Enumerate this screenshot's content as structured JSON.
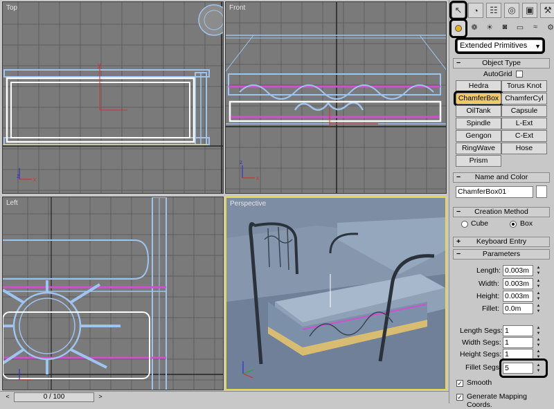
{
  "viewports": {
    "top": "Top",
    "front": "Front",
    "left": "Left",
    "perspective": "Perspective"
  },
  "panel": {
    "tabs_top": [
      "cursor-icon",
      "arc-icon",
      "hierarchy-icon",
      "motion-icon",
      "display-icon",
      "utilities-icon"
    ],
    "tabs_sub": [
      "geometry-icon",
      "shapes-icon",
      "lights-icon",
      "cameras-icon",
      "helpers-icon",
      "spacewarps-icon",
      "systems-icon"
    ],
    "dropdown": "Extended Primitives",
    "object_type": {
      "title": "Object Type",
      "autogrid": "AutoGrid",
      "buttons": [
        "Hedra",
        "Torus Knot",
        "ChamferBox",
        "ChamferCyl",
        "OilTank",
        "Capsule",
        "Spindle",
        "L-Ext",
        "Gengon",
        "C-Ext",
        "RingWave",
        "Hose",
        "Prism"
      ]
    },
    "name_color": {
      "title": "Name and Color",
      "name": "ChamferBox01"
    },
    "creation_method": {
      "title": "Creation Method",
      "cube": "Cube",
      "box": "Box"
    },
    "keyboard_entry": {
      "title": "Keyboard Entry"
    },
    "parameters": {
      "title": "Parameters",
      "length_label": "Length:",
      "length": "0.003m",
      "width_label": "Width:",
      "width": "0.003m",
      "height_label": "Height:",
      "height": "0.003m",
      "fillet_label": "Fillet:",
      "fillet": "0.0m",
      "length_segs_label": "Length Segs:",
      "length_segs": "1",
      "width_segs_label": "Width Segs:",
      "width_segs": "1",
      "height_segs_label": "Height Segs:",
      "height_segs": "1",
      "fillet_segs_label": "Fillet Segs:",
      "fillet_segs": "5",
      "smooth": "Smooth",
      "gen_mapping": "Generate Mapping Coords."
    }
  },
  "status": {
    "time_slider": "0 / 100"
  },
  "colors": {
    "viewport_bg": "#7a7a7a",
    "wire_blue": "#9fc4f0",
    "wire_magenta": "#d050d0",
    "selected_white": "#ffffff",
    "active_border": "#e8d84a",
    "highlight_button": "#f1c86a"
  }
}
